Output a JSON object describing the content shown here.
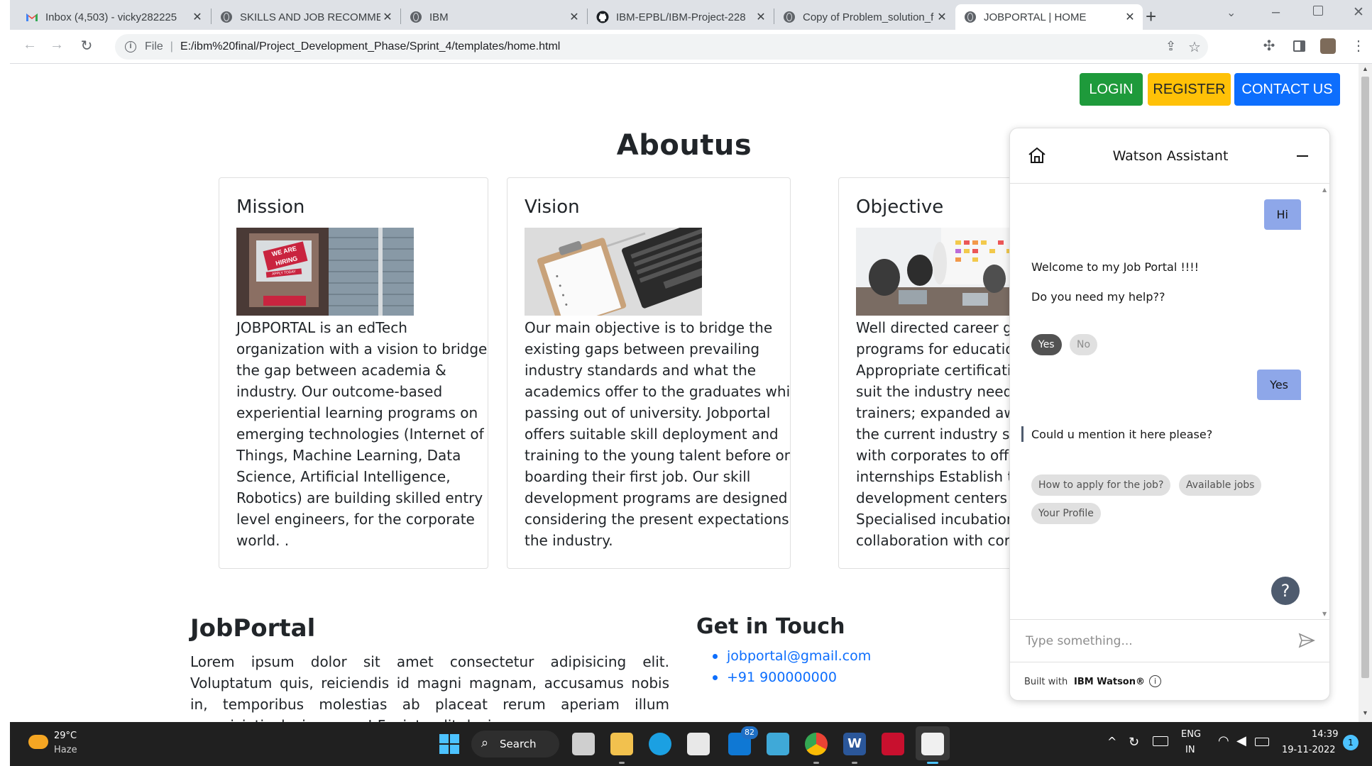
{
  "browser": {
    "tabs": [
      {
        "title": "Inbox (4,503) - vicky282225",
        "icon": "gmail-icon"
      },
      {
        "title": "SKILLS AND JOB RECOMME",
        "icon": "globe-icon"
      },
      {
        "title": "IBM",
        "icon": "globe-icon"
      },
      {
        "title": "IBM-EPBL/IBM-Project-228",
        "icon": "github-icon"
      },
      {
        "title": "Copy of Problem_solution_f",
        "icon": "globe-icon"
      },
      {
        "title": "JOBPORTAL | HOME",
        "icon": "globe-icon",
        "active": true
      }
    ],
    "address": {
      "scheme_label": "File",
      "url": "E:/ibm%20final/Project_Development_Phase/Sprint_4/templates/home.html"
    }
  },
  "nav": {
    "login": "LOGIN",
    "register": "REGISTER",
    "contact": "CONTACT US"
  },
  "about": {
    "title": "Aboutus",
    "cards": [
      {
        "heading": "Mission",
        "image_text": "WE ARE HIRING",
        "image_sub": "APPLY TODAY",
        "lines": [
          "JOBPORTAL is an edTech",
          "organization with a vision to bridge",
          "the gap between academia &",
          "industry. Our outcome-based",
          "experiential learning programs on",
          "emerging technologies (Internet of",
          "Things, Machine Learning, Data",
          "Science, Artificial Intelligence,",
          "Robotics) are building skilled entry -",
          "level engineers, for the corporate",
          "world. ."
        ]
      },
      {
        "heading": "Vision",
        "lines": [
          "Our main objective is to bridge the",
          "existing gaps between prevailing",
          "industry standards and what the",
          "academics offer to the graduates while",
          "passing out of university. Jobportal",
          "offers suitable skill deployment and",
          "training to the young talent before on",
          "boarding their first job. Our skill",
          "development programs are designed",
          "considering the present expectations in",
          "the industry."
        ]
      },
      {
        "heading": "Objective",
        "lines": [
          "Well directed career guid",
          "programs for educationa",
          "Appropriate certification",
          "suit the industry need Tr",
          "trainers; expanded aware",
          "the current industry stan",
          "with corporates to offer",
          "internships Establish tech",
          "development centers in c",
          "Specialised incubation ce",
          "collaboration with corpo"
        ]
      }
    ]
  },
  "footer": {
    "brand": "JobPortal",
    "text": "Lorem ipsum dolor sit amet consectetur adipisicing elit. Voluptatum quis, reiciendis id magni magnam, accusamus nobis in, temporibus molestias ab placeat rerum aperiam illum perspiciatis ducimus non! Fugiat, odit ducimus.",
    "contact_heading": "Get in Touch",
    "email": "jobportal@gmail.com",
    "phone": "+91 900000000"
  },
  "watson": {
    "title": "Watson Assistant",
    "messages": {
      "user_hi": "Hi",
      "welcome": "Welcome to my Job Portal !!!!",
      "help": "Do you need my help??",
      "user_yes": "Yes",
      "mention": "Could u mention it here please?"
    },
    "chips_yes_no": [
      "Yes",
      "No"
    ],
    "chips_options": [
      "How to apply for the job?",
      "Available jobs",
      "Your Profile"
    ],
    "input_placeholder": "Type something...",
    "footer_prefix": "Built with",
    "footer_brand": "IBM Watson®"
  },
  "taskbar": {
    "weather_temp": "29°C",
    "weather_desc": "Haze",
    "search_label": "Search",
    "badge_count": "82",
    "lang_top": "ENG",
    "lang_bottom": "IN",
    "time": "14:39",
    "date": "19-11-2022",
    "notification_count": "1"
  },
  "colors": {
    "login": "#1e9a3b",
    "register": "#ffc107",
    "contact": "#0d6efd",
    "watson_user_bubble": "#8ea7e9"
  }
}
